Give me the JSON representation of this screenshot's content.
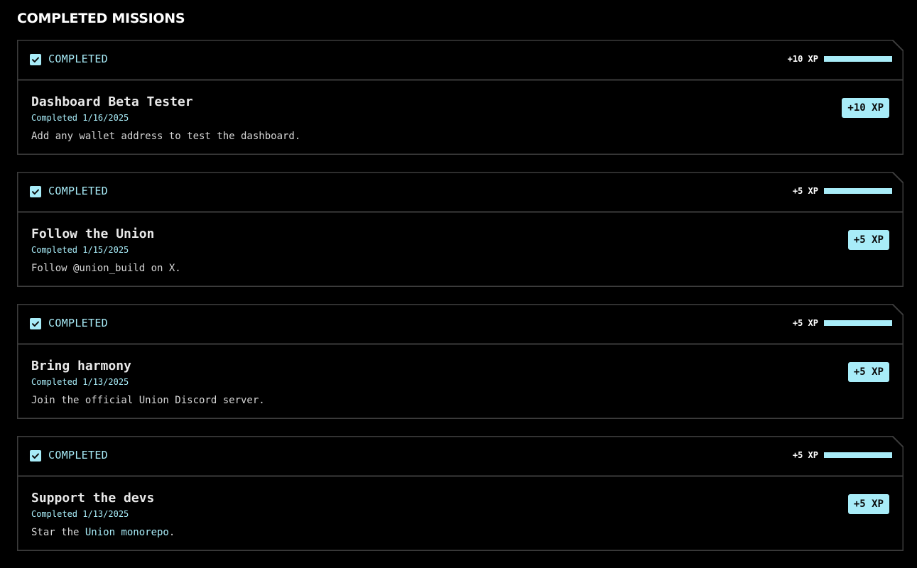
{
  "page": {
    "title": "COMPLETED MISSIONS"
  },
  "colors": {
    "background": "#000000",
    "accent": "#a8ecf8",
    "border": "#3c3c3c",
    "text": "#e8e8e8"
  },
  "missions": [
    {
      "status": "COMPLETED",
      "header_xp": "+10 XP",
      "progress": 1.0,
      "title": "Dashboard Beta Tester",
      "completed": "Completed 1/16/2025",
      "description": "Add any wallet address to test the dashboard.",
      "xp_badge": "+10 XP"
    },
    {
      "status": "COMPLETED",
      "header_xp": "+5 XP",
      "progress": 1.0,
      "title": "Follow the Union",
      "completed": "Completed 1/15/2025",
      "description": "Follow @union_build on X.",
      "xp_badge": "+5 XP"
    },
    {
      "status": "COMPLETED",
      "header_xp": "+5 XP",
      "progress": 1.0,
      "title": "Bring harmony",
      "completed": "Completed 1/13/2025",
      "description": "Join the official Union Discord server.",
      "xp_badge": "+5 XP"
    },
    {
      "status": "COMPLETED",
      "header_xp": "+5 XP",
      "progress": 1.0,
      "title": "Support the devs",
      "completed": "Completed 1/13/2025",
      "description_prefix": "Star the ",
      "description_link": "Union monorepo",
      "description_suffix": ".",
      "xp_badge": "+5 XP"
    }
  ]
}
